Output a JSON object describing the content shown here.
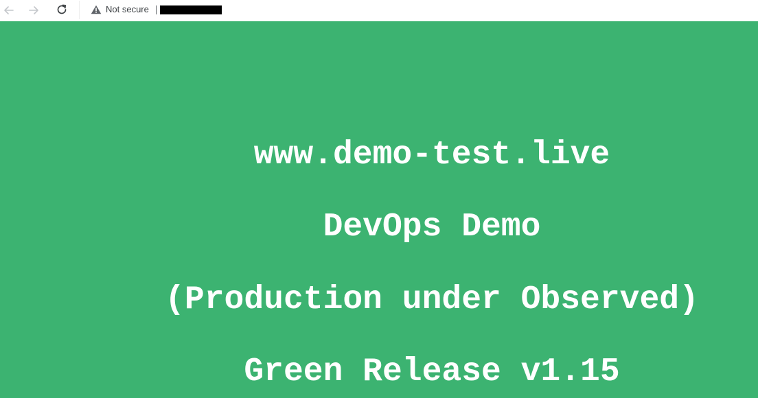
{
  "browser": {
    "security_label": "Not secure",
    "icons": {
      "back": "arrow-left-icon",
      "forward": "arrow-right-icon",
      "reload": "reload-icon",
      "warning": "warning-triangle-icon"
    }
  },
  "page": {
    "background_color": "#3cb371",
    "text_color": "#ffffff",
    "lines": [
      "www.demo-test.live",
      "DevOps Demo",
      "(Production under Observed)",
      "Green Release v1.15"
    ]
  }
}
